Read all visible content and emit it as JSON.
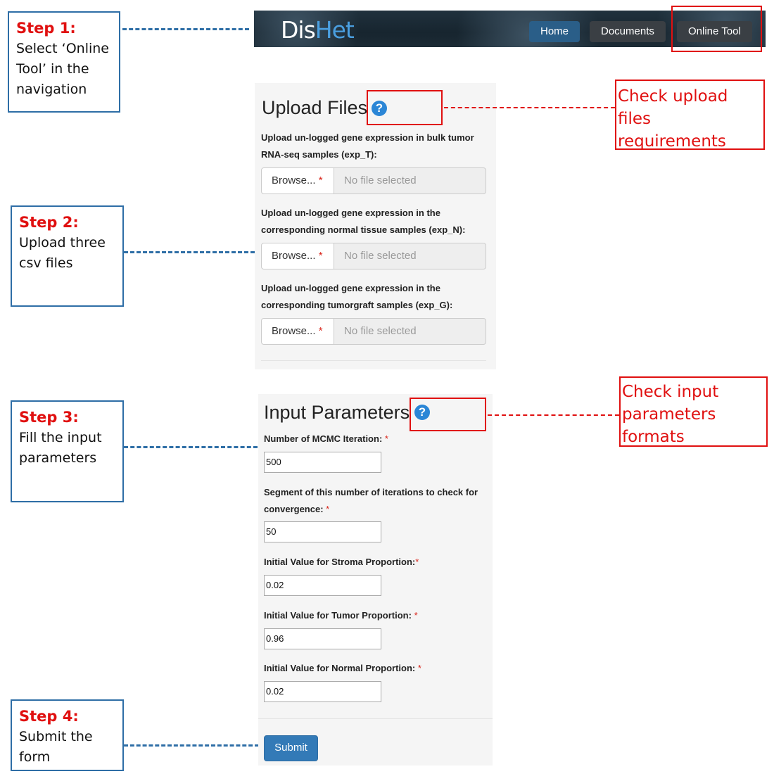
{
  "steps": [
    {
      "title": "Step 1:",
      "description": "Select ‘Online\nTool’ in the\nnavigation"
    },
    {
      "title": "Step 2:",
      "description": "Upload three\ncsv files"
    },
    {
      "title": "Step 3:",
      "description": "Fill the input\nparameters"
    },
    {
      "title": "Step 4:",
      "description": "Submit the\nform"
    }
  ],
  "notes": {
    "upload": [
      "Check upload files",
      "requirements"
    ],
    "params": [
      "Check input",
      "parameters",
      "formats"
    ]
  },
  "navbar": {
    "logo_part1": "Dis",
    "logo_part2": "Het",
    "items": [
      "Home",
      "Documents",
      "Online Tool"
    ]
  },
  "upload": {
    "title": "Upload Files",
    "help_icon": "?",
    "fields": [
      {
        "label_line1": "Upload un-logged gene expression in bulk tumor",
        "label_line2": "RNA-seq samples (exp_T):"
      },
      {
        "label_line1": "Upload un-logged gene expression in the",
        "label_line2": "corresponding normal tissue samples (exp_N):"
      },
      {
        "label_line1": "Upload un-logged gene expression in the",
        "label_line2": "corresponding tumorgraft samples (exp_G):"
      }
    ],
    "browse_label": "Browse...",
    "required_mark": "*",
    "no_file_text": "No file selected"
  },
  "params": {
    "title": "Input Parameters",
    "help_icon": "?",
    "required_mark": "*",
    "fields": [
      {
        "label_line1": "Number of MCMC Iteration:",
        "label_line2": "",
        "value": "500"
      },
      {
        "label_line1": "Segment of this number of iterations to check for",
        "label_line2": "convergence:",
        "value": "50"
      },
      {
        "label_line1": "Initial Value for Stroma Proportion:",
        "label_line2": "",
        "value": "0.02"
      },
      {
        "label_line1": "Initial Value for Tumor Proportion:",
        "label_line2": "",
        "value": "0.96"
      },
      {
        "label_line1": "Initial Value for Normal Proportion:",
        "label_line2": "",
        "value": "0.02"
      }
    ],
    "submit_label": "Submit"
  }
}
